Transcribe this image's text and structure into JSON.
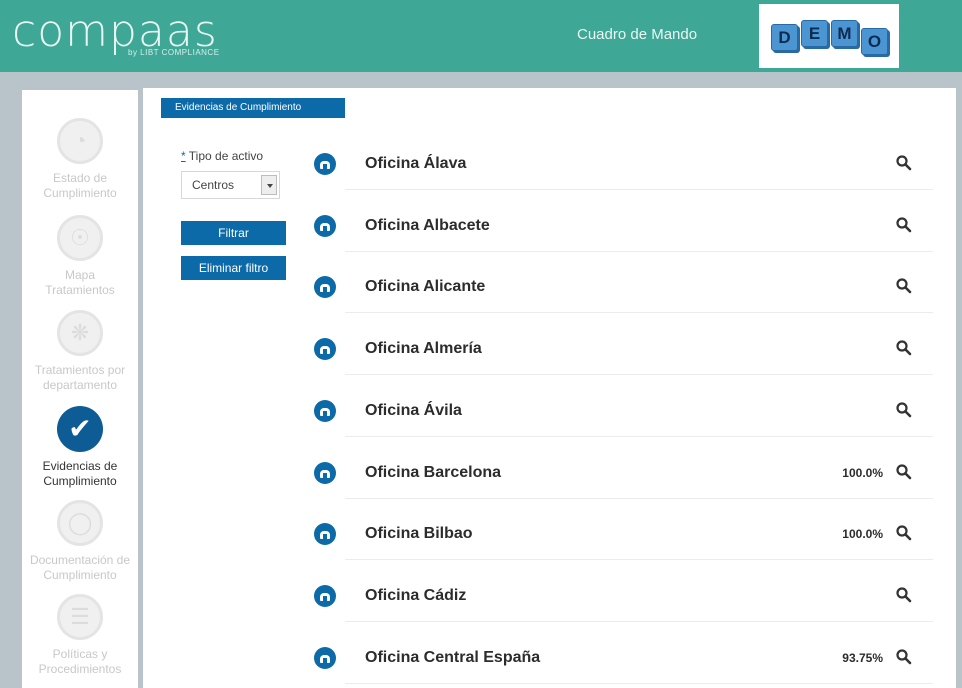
{
  "header": {
    "logo_text": "compaas",
    "logo_sub": "by LIBT COMPLIANCE",
    "nav_label": "Cuadro de Mando",
    "demo_letters": [
      "D",
      "E",
      "M",
      "O"
    ]
  },
  "sidebar": {
    "items": [
      {
        "label": "Estado de Cumplimiento",
        "icon": "gauge-icon",
        "active": false
      },
      {
        "label": "Mapa Tratamientos",
        "icon": "globe-icon",
        "active": false
      },
      {
        "label": "Tratamientos por departamento",
        "icon": "org-icon",
        "active": false
      },
      {
        "label": "Evidencias de Cumplimiento",
        "icon": "check-icon",
        "active": true
      },
      {
        "label": "Documentación de Cumplimiento",
        "icon": "lock-icon",
        "active": false
      },
      {
        "label": "Políticas y Procedimientos",
        "icon": "document-icon",
        "active": false
      }
    ]
  },
  "main": {
    "section_title": "Evidencias de Cumplimiento",
    "filter": {
      "required_mark": "*",
      "label": "Tipo de activo",
      "selected": "Centros",
      "filter_button": "Filtrar",
      "clear_button": "Eliminar filtro"
    },
    "rows": [
      {
        "name": "Oficina Álava",
        "pct": ""
      },
      {
        "name": "Oficina Albacete",
        "pct": ""
      },
      {
        "name": "Oficina Alicante",
        "pct": ""
      },
      {
        "name": "Oficina Almería",
        "pct": ""
      },
      {
        "name": "Oficina Ávila",
        "pct": ""
      },
      {
        "name": "Oficina Barcelona",
        "pct": "100.0%"
      },
      {
        "name": "Oficina Bilbao",
        "pct": "100.0%"
      },
      {
        "name": "Oficina Cádiz",
        "pct": ""
      },
      {
        "name": "Oficina Central España",
        "pct": "93.75%"
      }
    ]
  },
  "colors": {
    "header": "#3ea796",
    "accent": "#0d6aa8",
    "active_icon": "#0d5c95"
  }
}
